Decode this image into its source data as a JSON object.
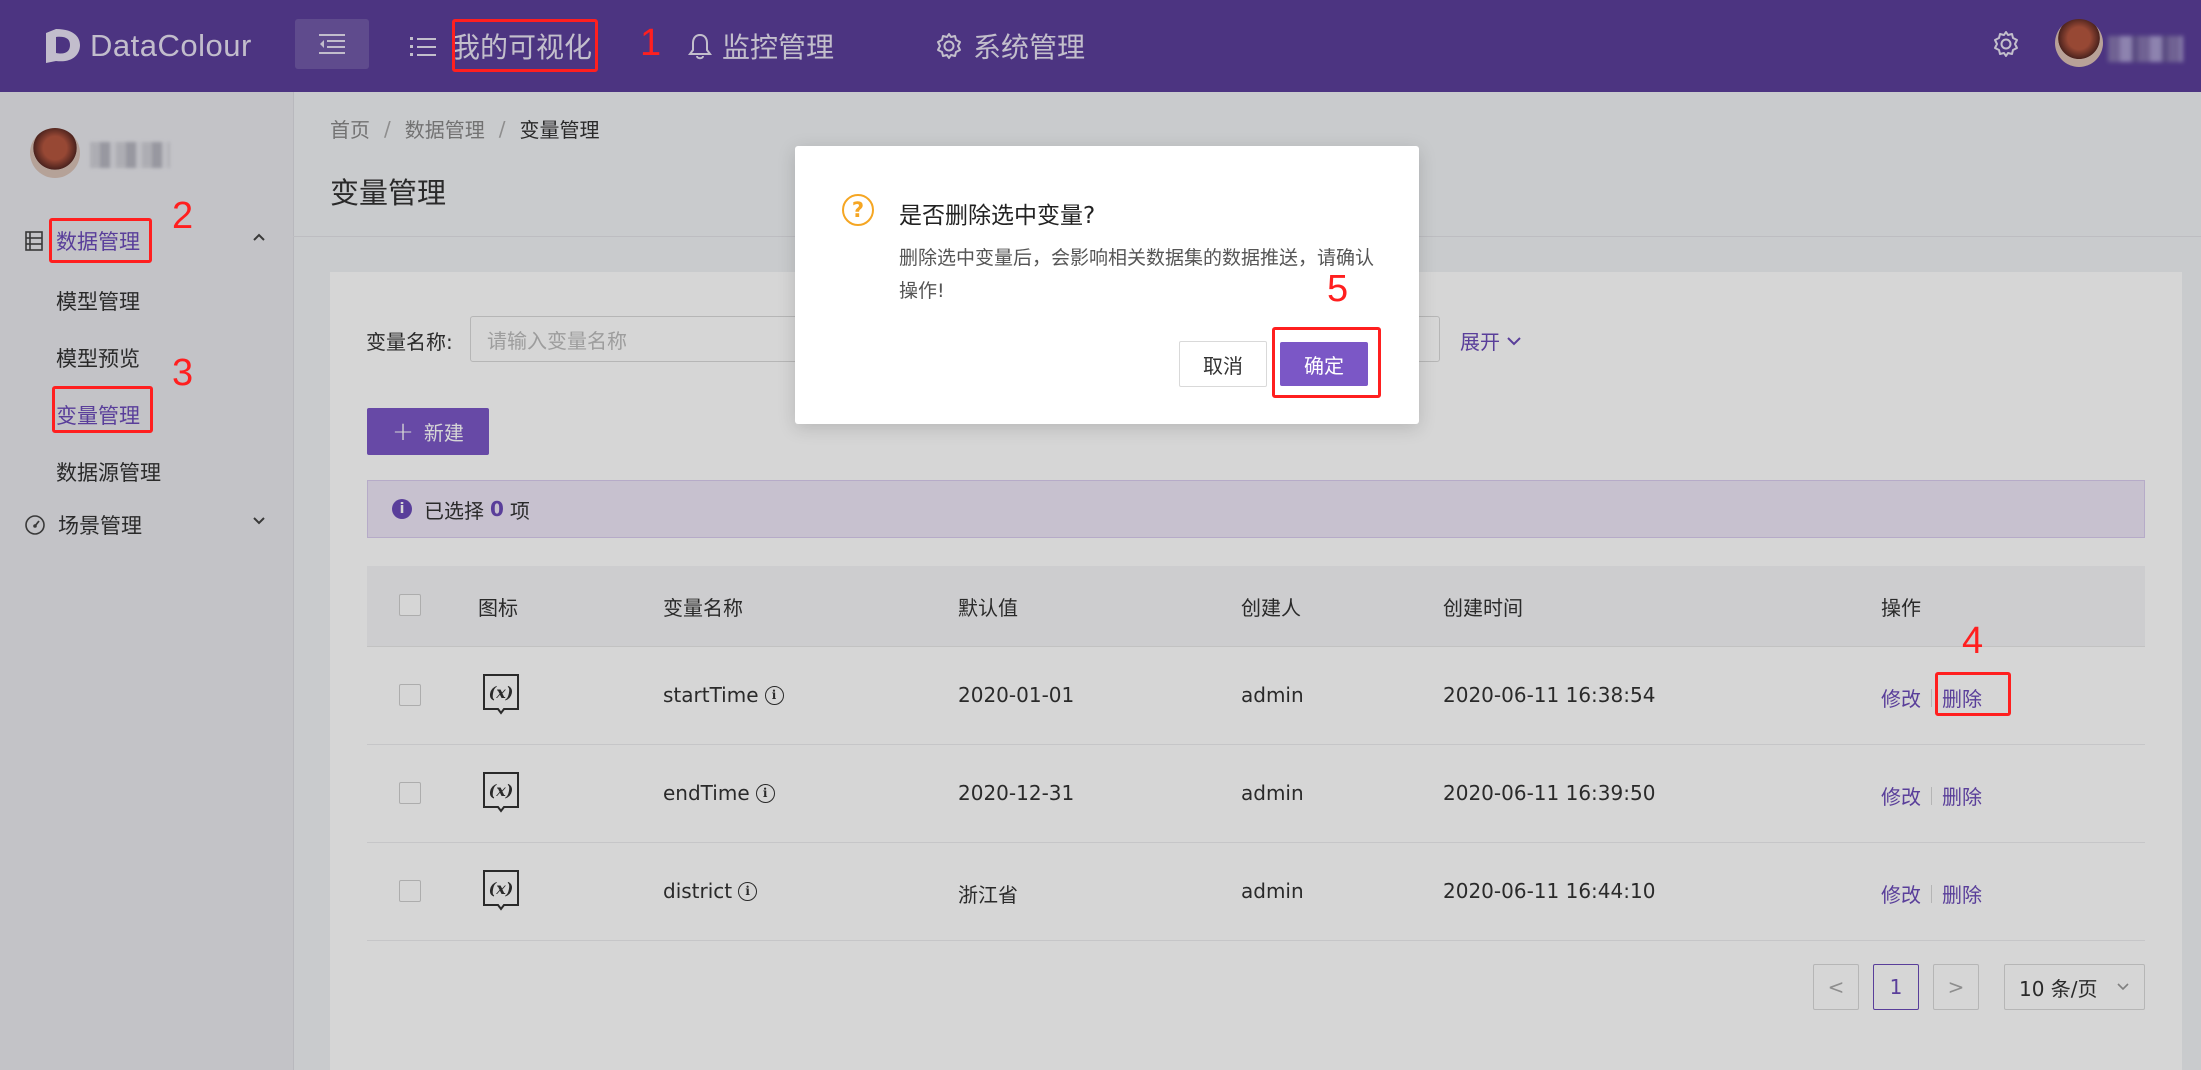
{
  "app": {
    "logo_text": "DataColour"
  },
  "topnav": {
    "items": [
      {
        "label": "我的可视化"
      },
      {
        "label": "监控管理"
      },
      {
        "label": "系统管理"
      }
    ]
  },
  "sidebar": {
    "groups": [
      {
        "label": "数据管理",
        "children": [
          "模型管理",
          "模型预览",
          "变量管理",
          "数据源管理"
        ]
      },
      {
        "label": "场景管理"
      }
    ]
  },
  "breadcrumb": [
    "首页",
    "数据管理",
    "变量管理"
  ],
  "page": {
    "title": "变量管理"
  },
  "filter": {
    "label": "变量名称:",
    "placeholder": "请输入变量名称",
    "expand_label": "展开"
  },
  "toolbar": {
    "new_label": "新建"
  },
  "selection": {
    "prefix": "已选择",
    "count": "0",
    "suffix": "项"
  },
  "table": {
    "headers": [
      "图标",
      "变量名称",
      "默认值",
      "创建人",
      "创建时间",
      "操作"
    ],
    "rows": [
      {
        "name": "startTime",
        "default": "2020-01-01",
        "creator": "admin",
        "created": "2020-06-11 16:38:54"
      },
      {
        "name": "endTime",
        "default": "2020-12-31",
        "creator": "admin",
        "created": "2020-06-11 16:39:50"
      },
      {
        "name": "district",
        "default": "浙江省",
        "creator": "admin",
        "created": "2020-06-11 16:44:10"
      }
    ],
    "edit_label": "修改",
    "delete_label": "删除"
  },
  "pagination": {
    "prev": "<",
    "current": "1",
    "next": ">",
    "page_size": "10 条/页"
  },
  "dialog": {
    "title": "是否删除选中变量?",
    "content": "删除选中变量后，会影响相关数据集的数据推送，请确认操作!",
    "cancel_label": "取消",
    "ok_label": "确定"
  },
  "annotations": [
    "1",
    "2",
    "3",
    "4",
    "5"
  ],
  "colors": {
    "primary": "#7b57c6",
    "header_bg": "#5b3f9a",
    "annotation": "#ff1f1f",
    "warning": "#f5a623"
  }
}
